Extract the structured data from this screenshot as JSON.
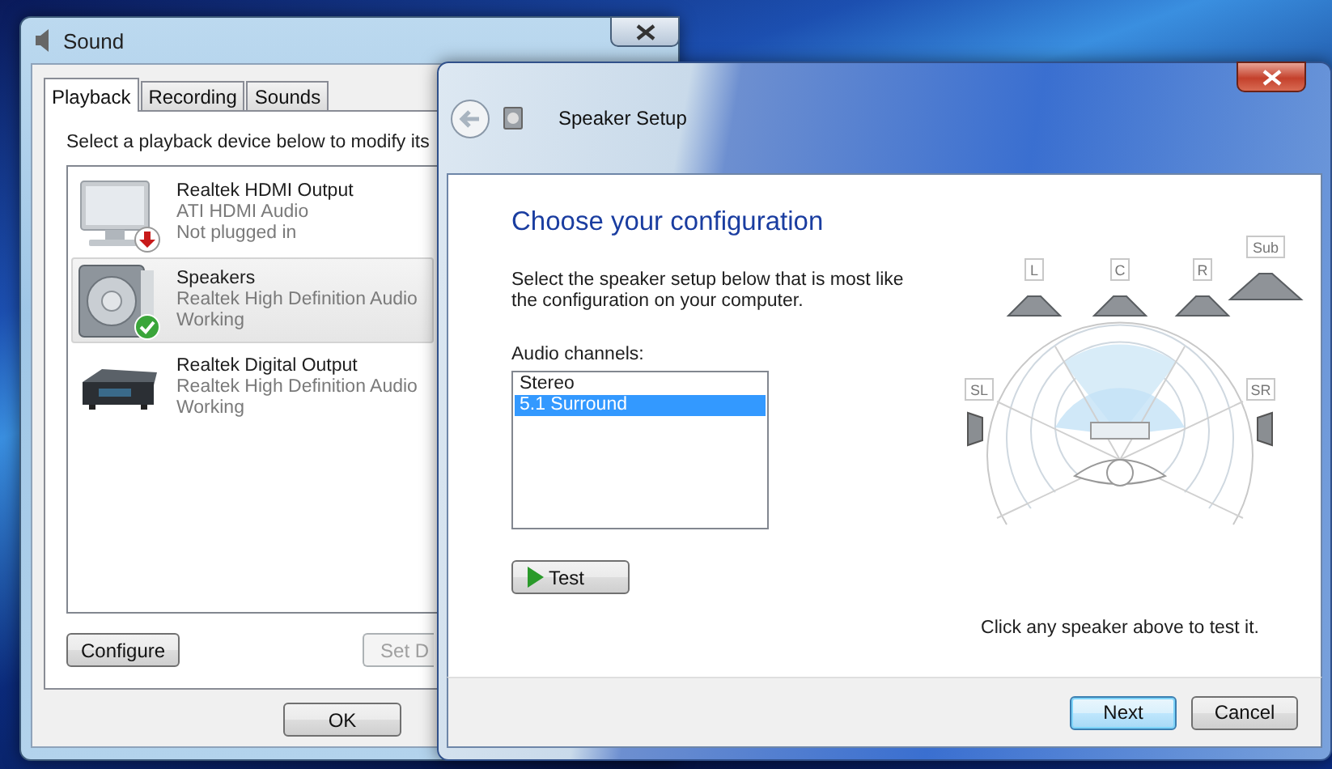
{
  "sound_window": {
    "title": "Sound",
    "tabs": [
      {
        "label": "Playback",
        "selected": true
      },
      {
        "label": "Recording",
        "selected": false
      },
      {
        "label": "Sounds",
        "selected": false
      }
    ],
    "instruction": "Select a playback device below to modify its",
    "devices": [
      {
        "kind": "monitor",
        "name": "Realtek HDMI Output",
        "driver": "ATI HDMI Audio",
        "status": "Not plugged in",
        "badge": {
          "kind": "unplugged"
        },
        "selected": false
      },
      {
        "kind": "speaker",
        "name": "Speakers",
        "driver": "Realtek High Definition Audio",
        "status": "Working",
        "badge": {
          "kind": "working"
        },
        "selected": true
      },
      {
        "kind": "receiver",
        "name": "Realtek Digital Output",
        "driver": "Realtek High Definition Audio",
        "status": "Working",
        "selected": false
      }
    ],
    "configure_button": {
      "label": "Configure",
      "disabled": false
    },
    "set_default_button": {
      "label": "Set D",
      "disabled": true
    },
    "ok_button": "OK"
  },
  "speaker_setup": {
    "title": "Speaker Setup",
    "heading": "Choose your configuration",
    "description": "Select the speaker setup below that is most like the configuration on your computer.",
    "channels_label": "Audio channels:",
    "channels": [
      {
        "label": "Stereo",
        "selected": false
      },
      {
        "label": "5.1 Surround",
        "selected": true
      }
    ],
    "test_button": "Test",
    "speakers": [
      {
        "label": "L",
        "kind": "front-left"
      },
      {
        "label": "C",
        "kind": "center"
      },
      {
        "label": "R",
        "kind": "front-right"
      },
      {
        "label": "Sub",
        "kind": "subwoofer"
      },
      {
        "label": "SL",
        "kind": "side-left"
      },
      {
        "label": "SR",
        "kind": "side-right"
      }
    ],
    "hint": "Click any speaker above to test it.",
    "next_button": "Next",
    "cancel_button": "Cancel"
  }
}
